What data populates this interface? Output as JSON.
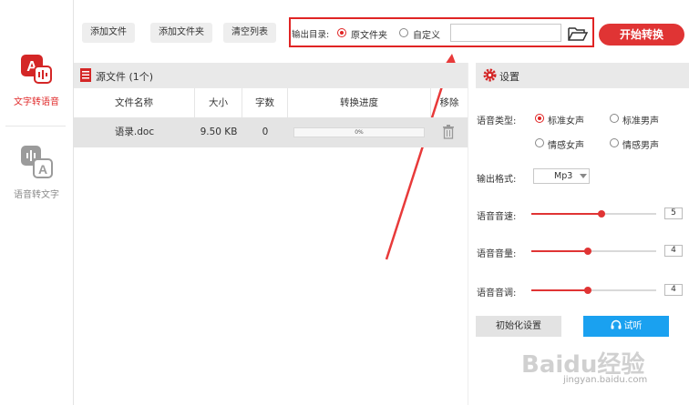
{
  "nav": {
    "items": [
      {
        "label": "文字转语音",
        "active": true
      },
      {
        "label": "语音转文字",
        "active": false
      }
    ],
    "accent": "#e02b2b"
  },
  "toolbar": {
    "add_file": "添加文件",
    "add_folder": "添加文件夹",
    "clear_list": "清空列表",
    "output_dir_label": "输出目录:",
    "option_original": "原文件夹",
    "option_custom": "自定义",
    "selected_option": "原文件夹",
    "path_value": "",
    "start_button": "开始转换"
  },
  "files": {
    "title": "源文件 (1个)",
    "columns": [
      "文件名称",
      "大小",
      "字数",
      "转换进度",
      "移除"
    ],
    "rows": [
      {
        "name": "语录.doc",
        "size": "9.50 KB",
        "words": "0",
        "progress": "0%",
        "progress_value": 0
      }
    ]
  },
  "settings": {
    "title": "设置",
    "voice_type_label": "语音类型:",
    "voice_options": [
      "标准女声",
      "标准男声",
      "情感女声",
      "情感男声"
    ],
    "voice_selected": "标准女声",
    "format_label": "输出格式:",
    "format_value": "Mp3",
    "speed_label": "语音音速:",
    "speed_value": "5",
    "speed_fraction": 0.56,
    "volume_label": "语音音量:",
    "volume_value": "4",
    "volume_fraction": 0.45,
    "pitch_label": "语音音调:",
    "pitch_value": "4",
    "pitch_fraction": 0.45,
    "init_button": "初始化设置",
    "try_button": "试听",
    "accent": "#e03434",
    "try_color": "#1aa1f0"
  },
  "watermark": {
    "brand": "Baidu经验",
    "url": "jingyan.baidu.com"
  }
}
